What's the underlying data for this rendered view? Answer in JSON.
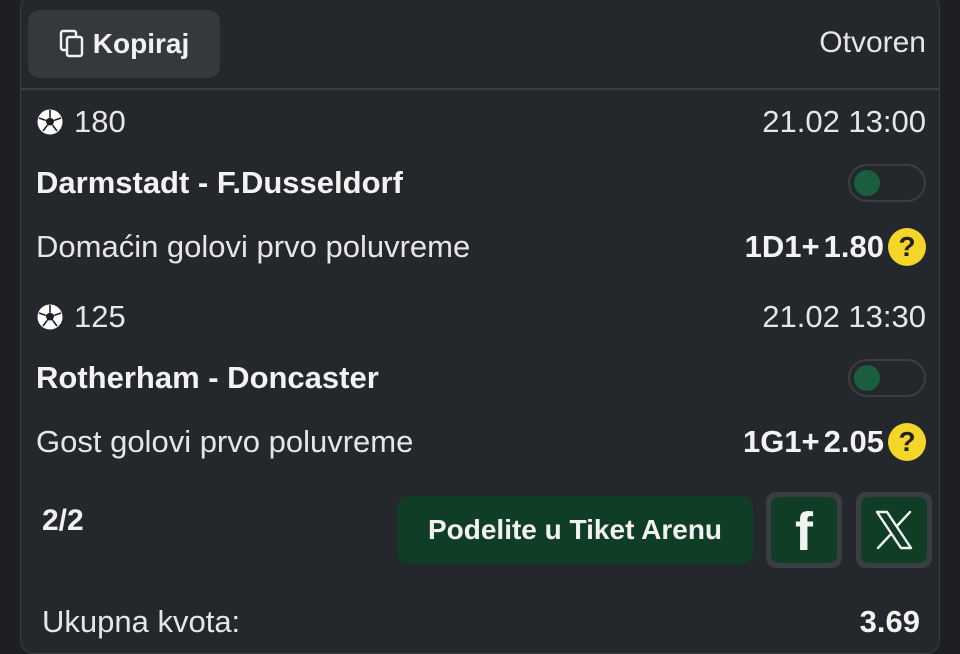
{
  "header": {
    "copy_label": "Kopiraj",
    "status": "Otvoren"
  },
  "events": [
    {
      "code": "180",
      "datetime": "21.02 13:00",
      "match": "Darmstadt - F.Dusseldorf",
      "market": "Domaćin golovi prvo poluvreme",
      "pick": "1D1+",
      "odd": "1.80",
      "help": "?"
    },
    {
      "code": "125",
      "datetime": "21.02 13:30",
      "match": "Rotherham - Doncaster",
      "market": "Gost golovi prvo poluvreme",
      "pick": "1G1+",
      "odd": "2.05",
      "help": "?"
    }
  ],
  "footer": {
    "pages": "2/2",
    "share_label": "Podelite u Tiket Arenu",
    "facebook_glyph": "f",
    "total_label": "Ukupna kvota:",
    "total_value": "3.69"
  },
  "colors": {
    "background": "#24272b",
    "accent_green": "#0f3d26",
    "help_yellow": "#f4d629"
  },
  "icons": [
    "copy-icon",
    "soccer-ball-icon",
    "help-icon",
    "facebook-icon",
    "x-icon"
  ]
}
